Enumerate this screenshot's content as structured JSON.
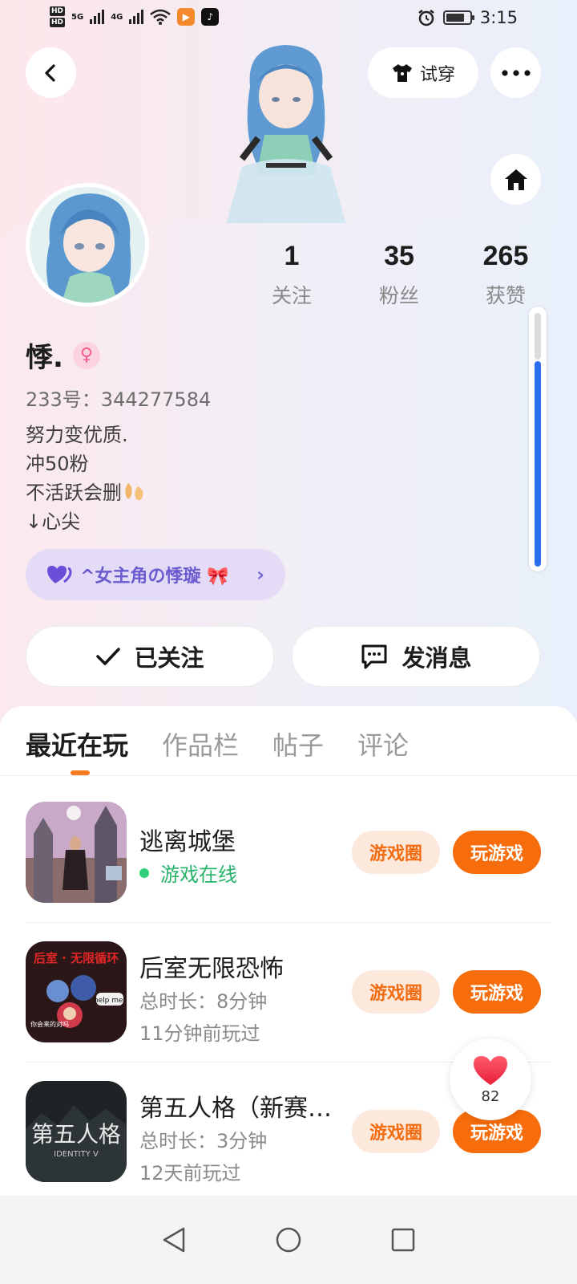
{
  "status_bar": {
    "network_1": "5G",
    "network_2": "4G",
    "hd_1": "HD",
    "hd_2": "HD",
    "time": "3:15"
  },
  "header": {
    "try_on_label": "试穿"
  },
  "profile": {
    "stats": [
      {
        "value": "1",
        "label": "关注"
      },
      {
        "value": "35",
        "label": "粉丝"
      },
      {
        "value": "265",
        "label": "获赞"
      }
    ],
    "name": "悸.",
    "gender_symbol": "♀",
    "id_line": "233号：344277584",
    "bio": [
      "努力变优质.",
      "冲50粉",
      "不活跃会删",
      "↓心尖"
    ],
    "group_chip_label": "^女主角の悸璇 🎀",
    "follow_button_label": "已关注",
    "message_button_label": "发消息"
  },
  "tabs": [
    {
      "label": "最近在玩",
      "active": true
    },
    {
      "label": "作品栏",
      "active": false
    },
    {
      "label": "帖子",
      "active": false
    },
    {
      "label": "评论",
      "active": false
    }
  ],
  "games": [
    {
      "title": "逃离城堡",
      "line1": "游戏在线",
      "line2": "",
      "circle_label": "游戏圈",
      "play_label": "玩游戏"
    },
    {
      "title": "后室无限恐怖",
      "line1": "总时长：8分钟",
      "line2": "11分钟前玩过",
      "circle_label": "游戏圈",
      "play_label": "玩游戏",
      "icon_text_1": "后室 · 无限循环",
      "icon_text_2": "help me!",
      "icon_text_3": "你会来的对吗"
    },
    {
      "title": "第五人格（新赛季）",
      "line1": "总时长：3分钟",
      "line2": "12天前玩过",
      "circle_label": "游戏圈",
      "play_label": "玩游戏",
      "icon_text_1": "第五人格",
      "icon_text_2": "IDENTITY V"
    }
  ],
  "like_float": {
    "count": "82"
  },
  "colors": {
    "accent_orange": "#f76c0b",
    "online_green": "#27b36a",
    "scroll_blue": "#2b6ef2",
    "chip_purple": "#6a5ccf"
  }
}
